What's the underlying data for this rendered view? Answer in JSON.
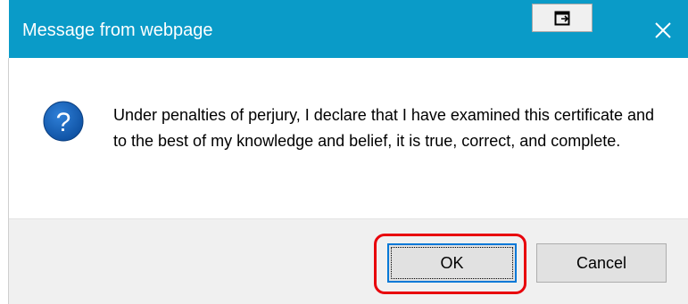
{
  "dialog": {
    "title": "Message from webpage",
    "message": "Under penalties of perjury, I declare that I have examined this certificate and to the best of my knowledge and belief, it is true, correct, and complete.",
    "icon": "question-icon",
    "close_icon": "close-icon",
    "restore_icon": "restore-window-icon"
  },
  "buttons": {
    "ok_label": "OK",
    "cancel_label": "Cancel"
  },
  "colors": {
    "titlebar": "#0a9bc8",
    "icon_blue": "#1565c0",
    "highlight": "#e8000b",
    "footer": "#f0f0f0"
  }
}
